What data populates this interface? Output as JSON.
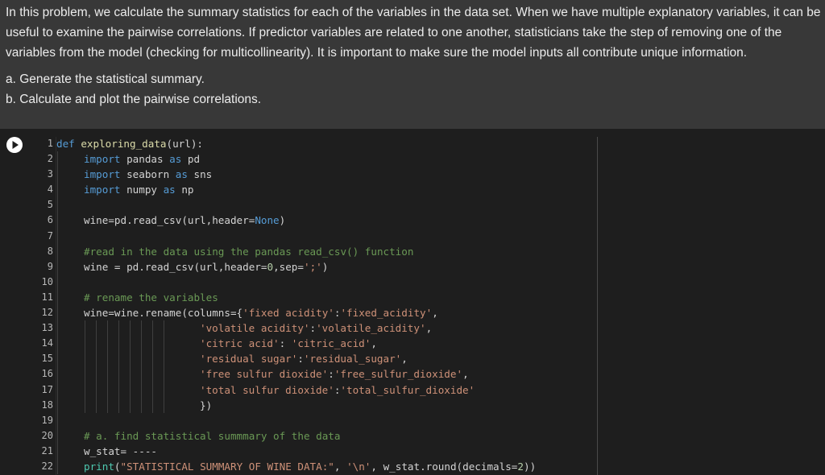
{
  "problem": {
    "paragraph": "In this problem, we calculate the summary statistics for each of the variables in the data set. When we have multiple explanatory variables, it can be useful to examine the pairwise correlations. If predictor variables are related to one another, statisticians take the step of removing one of the variables from the model (checking for multicollinearity). It is important to make sure the model inputs all contribute unique information.",
    "item_a": "a. Generate the statistical summary.",
    "item_b": "b. Calculate and plot the pairwise correlations."
  },
  "cell": {
    "run_icon": "play-icon",
    "line_numbers": [
      "1",
      "2",
      "3",
      "4",
      "5",
      "6",
      "7",
      "8",
      "9",
      "10",
      "11",
      "12",
      "13",
      "14",
      "15",
      "16",
      "17",
      "18",
      "19",
      "20",
      "21",
      "22"
    ],
    "lines": [
      [
        [
          "kw",
          "def "
        ],
        [
          "fn",
          "exploring_data"
        ],
        [
          "",
          "(url):"
        ]
      ],
      [
        [
          "kw",
          "import "
        ],
        [
          "",
          "pandas "
        ],
        [
          "kw",
          "as "
        ],
        [
          "",
          "pd"
        ]
      ],
      [
        [
          "kw",
          "import "
        ],
        [
          "",
          "seaborn "
        ],
        [
          "kw",
          "as "
        ],
        [
          "",
          "sns"
        ]
      ],
      [
        [
          "kw",
          "import "
        ],
        [
          "",
          "numpy "
        ],
        [
          "kw",
          "as "
        ],
        [
          "",
          "np"
        ]
      ],
      [],
      [
        [
          "",
          "wine=pd.read_csv(url,header="
        ],
        [
          "kw",
          "None"
        ],
        [
          "",
          ")"
        ]
      ],
      [],
      [
        [
          "c",
          "#read in the data using the pandas read_csv() function"
        ]
      ],
      [
        [
          "",
          "wine = pd.read_csv(url,header="
        ],
        [
          "num",
          "0"
        ],
        [
          "",
          ",sep="
        ],
        [
          "s",
          "';'"
        ],
        [
          "",
          ")"
        ]
      ],
      [],
      [
        [
          "c",
          "# rename the variables"
        ]
      ],
      [
        [
          "",
          "wine=wine.rename(columns={"
        ],
        [
          "s",
          "'fixed acidity'"
        ],
        [
          "",
          ":"
        ],
        [
          "s",
          "'fixed_acidity'"
        ],
        [
          "",
          ","
        ]
      ],
      [
        [
          "s",
          "'volatile acidity'"
        ],
        [
          "",
          ":"
        ],
        [
          "s",
          "'volatile_acidity'"
        ],
        [
          "",
          ","
        ]
      ],
      [
        [
          "s",
          "'citric acid'"
        ],
        [
          "",
          ": "
        ],
        [
          "s",
          "'citric_acid'"
        ],
        [
          "",
          ","
        ]
      ],
      [
        [
          "s",
          "'residual sugar'"
        ],
        [
          "",
          ":"
        ],
        [
          "s",
          "'residual_sugar'"
        ],
        [
          "",
          ","
        ]
      ],
      [
        [
          "s",
          "'free sulfur dioxide'"
        ],
        [
          "",
          ":"
        ],
        [
          "s",
          "'free_sulfur_dioxide'"
        ],
        [
          "",
          ","
        ]
      ],
      [
        [
          "s",
          "'total sulfur dioxide'"
        ],
        [
          "",
          ":"
        ],
        [
          "s",
          "'total_sulfur_dioxide'"
        ]
      ],
      [
        [
          "",
          "})"
        ]
      ],
      [],
      [
        [
          "c",
          "# a. find statistical summmary of the data"
        ]
      ],
      [
        [
          "",
          "w_stat= ----"
        ]
      ],
      [
        [
          "bi",
          "print"
        ],
        [
          "",
          "("
        ],
        [
          "s",
          "\"STATISTICAL SUMMARY OF WINE DATA:\""
        ],
        [
          "",
          ", "
        ],
        [
          "s",
          "'\\n'"
        ],
        [
          "",
          ", w_stat.round(decimals="
        ],
        [
          "num",
          "2"
        ],
        [
          "",
          "))"
        ]
      ]
    ]
  }
}
